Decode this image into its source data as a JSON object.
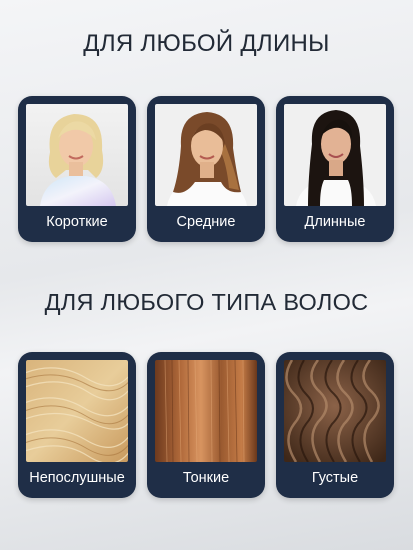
{
  "sections": [
    {
      "title": "ДЛЯ ЛЮБОЙ ДЛИНЫ",
      "cards": [
        {
          "label": "Короткие"
        },
        {
          "label": "Средние"
        },
        {
          "label": "Длинные"
        }
      ]
    },
    {
      "title": "ДЛЯ ЛЮБОГО ТИПА ВОЛОС",
      "cards": [
        {
          "label": "Непослушные"
        },
        {
          "label": "Тонкие"
        },
        {
          "label": "Густые"
        }
      ]
    }
  ],
  "colors": {
    "card_background": "#1f2e47",
    "title_text": "#222a36",
    "label_text": "#ffffff"
  }
}
